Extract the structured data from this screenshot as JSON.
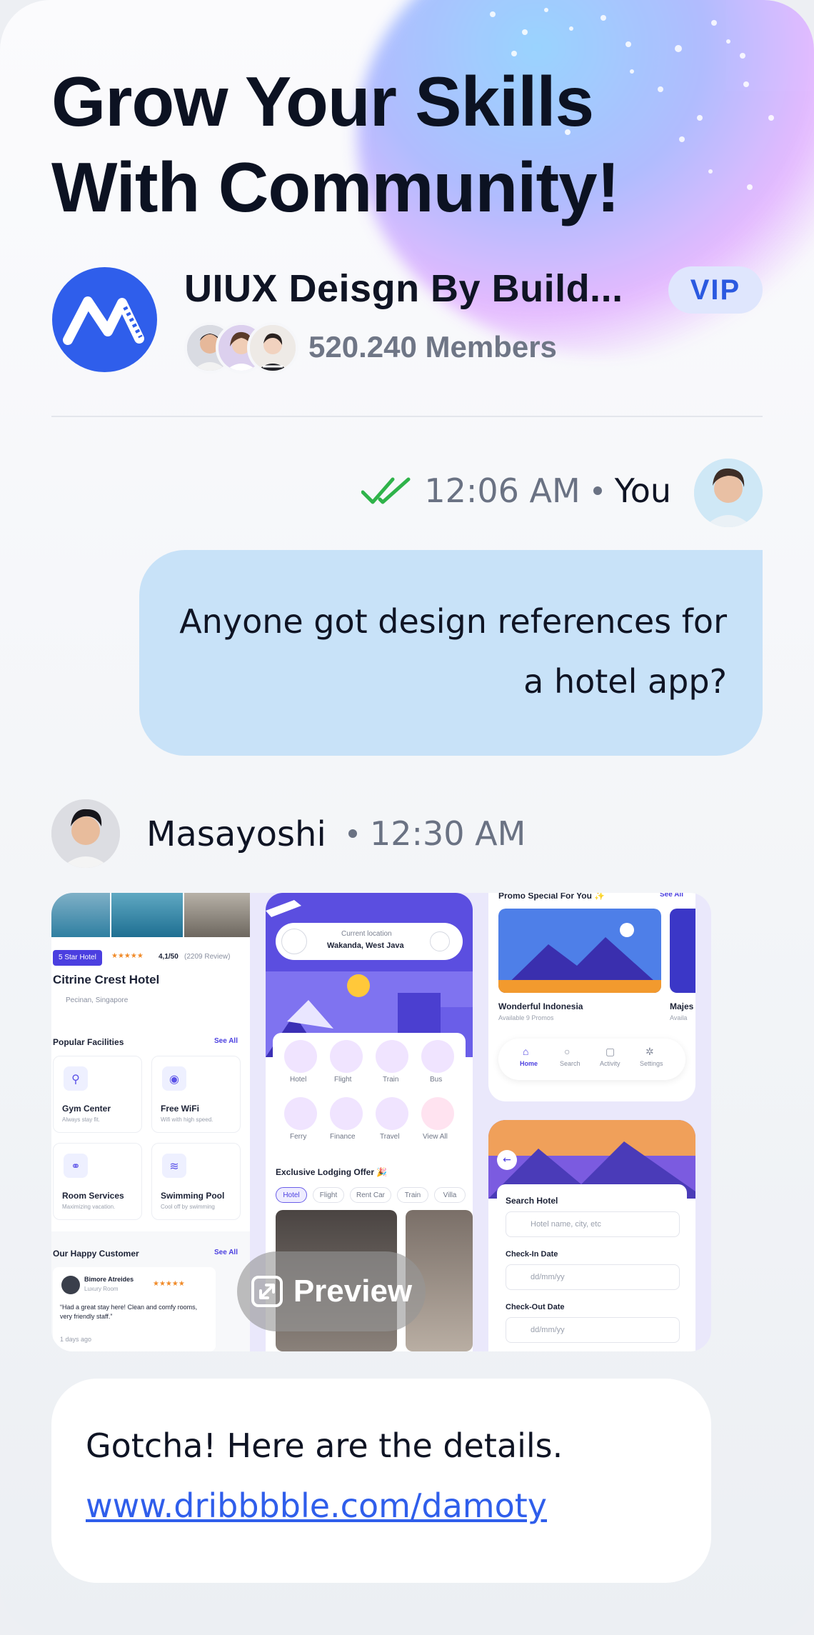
{
  "header": {
    "title_line1": "Grow Your Skills",
    "title_line2": "With Community!"
  },
  "group": {
    "name": "UIUX Deisgn By Build...",
    "badge": "VIP",
    "members": "520.240 Members"
  },
  "message1": {
    "time": "12:06 AM",
    "sender": "You",
    "text": "Anyone got design references for a hotel app?"
  },
  "message2": {
    "sender": "Masayoshi",
    "time": "12:30 AM",
    "preview_label": "Preview",
    "shot1": {
      "badge": "5 Star Hotel",
      "rating": "4,1/50",
      "reviews": "(2209 Review)",
      "hotel": "Citrine Crest Hotel",
      "location": "Pecinan, Singapore",
      "facilities_title": "Popular Facilities",
      "see_all": "See All",
      "facilities": [
        {
          "name": "Gym Center",
          "desc": "Always stay fit."
        },
        {
          "name": "Free WiFi",
          "desc": "Wifi with high speed."
        },
        {
          "name": "Room Services",
          "desc": "Maximizing vacation."
        },
        {
          "name": "Swimming Pool",
          "desc": "Cool off by swimming"
        }
      ],
      "customer_title": "Our Happy Customer",
      "customer_name": "Bimore Atreides",
      "customer_room": "Luxury Room",
      "quote": "“Had a great stay here! Clean and comfy rooms, very friendly staff.”",
      "ago": "1 days ago"
    },
    "shot2": {
      "loc_label": "Current location",
      "loc_value": "Wakanda, West Java",
      "categories": [
        "Hotel",
        "Flight",
        "Train",
        "Bus",
        "Ferry",
        "Finance",
        "Travel",
        "View All"
      ],
      "offer_title": "Exclusive Lodging Offer 🎉",
      "tabs": [
        "Hotel",
        "Flight",
        "Rent Car",
        "Train",
        "Villa"
      ]
    },
    "shot3": {
      "promo_title": "Promo Special For You ✨",
      "see_all": "See All",
      "card_title": "Wonderful Indonesia",
      "card_sub": "Available 9 Promos",
      "card2_title": "Majes",
      "card2_sub": "Availa",
      "nav": [
        "Home",
        "Search",
        "Activity",
        "Settings"
      ]
    },
    "shot4": {
      "search_title": "Search Hotel",
      "search_ph": "Hotel name, city, etc",
      "checkin": "Check-In Date",
      "checkout": "Check-Out Date",
      "date_ph": "dd/mm/yy"
    }
  },
  "message3": {
    "text": "Gotcha! Here are the details.",
    "link": "www.dribbbble.com/damoty"
  },
  "colors": {
    "accent": "#2f5eeb",
    "bubble_sent": "#c8e2f8",
    "check_green": "#2fb34a"
  }
}
